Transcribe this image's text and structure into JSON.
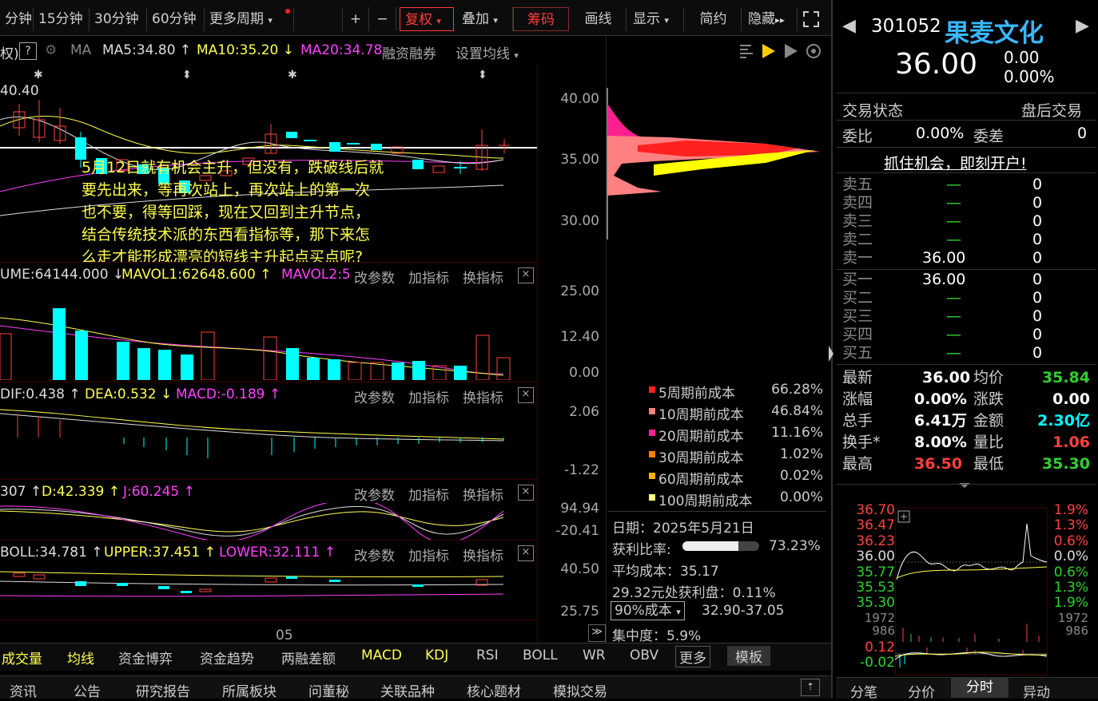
{
  "toolbar": {
    "periods": [
      "分钟",
      "15分钟",
      "30分钟",
      "60分钟",
      "更多周期"
    ],
    "plus": "+",
    "minus": "−",
    "fuquan": "复权",
    "diejia": "叠加",
    "chouma": "筹码",
    "huaxian": "画线",
    "xianshi": "显示",
    "jianyue": "简约",
    "yincang": "隐藏"
  },
  "ma_bar": {
    "prefix": "权)",
    "help": "?",
    "ma": "MA",
    "ma5": "MA5:34.80",
    "ma10": "MA10:35.20",
    "ma20": "MA20:34.78",
    "rongzi": "融资融券",
    "shezhi": "设置均线"
  },
  "price_chart": {
    "high_label": "40.40",
    "y_ticks": [
      "40.00",
      "35.00",
      "30.00"
    ],
    "annotation": [
      "5月12日就有机会主升，但没有，跌破线后就",
      "要先出来，等再次站上，再次站上的第一次",
      "也不要，得等回踩，现在又回到主升节点，",
      "结合传统技术派的东西看指标等，那下来怎",
      "么走才能形成漂亮的短线主升起点买点呢?"
    ]
  },
  "volume": {
    "vol": "UME:64144.000",
    "mavol1": "MAVOL1:62648.600",
    "mavol2": "MAVOL2:5",
    "y_ticks": [
      "25.00",
      "12.40",
      "0.00"
    ]
  },
  "macd": {
    "dif": "DIF:0.438",
    "dea": "DEA:0.532",
    "macd": "MACD:-0.189",
    "y_ticks": [
      "2.06",
      "-1.22"
    ]
  },
  "kdj": {
    "k": "307",
    "d": "D:42.339",
    "j": "J:60.245",
    "y_ticks": [
      "94.94",
      "-20.41"
    ]
  },
  "boll": {
    "boll": "BOLL:34.781",
    "upper": "UPPER:37.451",
    "lower": "LOWER:32.111",
    "y_ticks": [
      "40.50",
      "25.75"
    ]
  },
  "pane_buttons": {
    "gaicanshu": "改参数",
    "jiazhibiao": "加指标",
    "huanzhibiao": "换指标",
    "close": "×"
  },
  "x_axis_label": "05",
  "chip": {
    "legend": [
      {
        "label": "5周期前成本",
        "value": "66.28%",
        "color": "#ff2020"
      },
      {
        "label": "10周期前成本",
        "value": "46.84%",
        "color": "#ff8080"
      },
      {
        "label": "20周期前成本",
        "value": "11.16%",
        "color": "#ff2090"
      },
      {
        "label": "30周期前成本",
        "value": "1.02%",
        "color": "#ff8000"
      },
      {
        "label": "60周期前成本",
        "value": "0.02%",
        "color": "#ffb000"
      },
      {
        "label": "100周期前成本",
        "value": "0.00%",
        "color": "#ffff80"
      }
    ],
    "date": "日期：2025年5月21日",
    "profit_label": "获利比率:",
    "profit_value": "73.23%",
    "profit_ratio": 0.7323,
    "avg_cost": "平均成本：35.17",
    "profit_at": "29.32元处获利盘：0.11%",
    "cost_select": "90%成本",
    "cost_range": "32.90-37.05",
    "concentration": "集中度：5.9%"
  },
  "stock": {
    "code": "301052",
    "name": "果麦文化",
    "price": "36.00",
    "change": "0.00",
    "change_pct": "0.00%"
  },
  "quote": {
    "status_label": "交易状态",
    "status_value": "盘后交易",
    "weibi_label": "委比",
    "weibi_value": "0.00%",
    "weicha_label": "委差",
    "weicha_value": "0",
    "promo": "抓住机会，即刻开户!",
    "asks": [
      {
        "label": "卖五",
        "price": "—",
        "vol": "0"
      },
      {
        "label": "卖四",
        "price": "—",
        "vol": "0"
      },
      {
        "label": "卖三",
        "price": "—",
        "vol": "0"
      },
      {
        "label": "卖二",
        "price": "—",
        "vol": "0"
      },
      {
        "label": "卖一",
        "price": "36.00",
        "vol": "0"
      }
    ],
    "bids": [
      {
        "label": "买一",
        "price": "36.00",
        "vol": "0"
      },
      {
        "label": "买二",
        "price": "—",
        "vol": "0"
      },
      {
        "label": "买三",
        "price": "—",
        "vol": "0"
      },
      {
        "label": "买四",
        "price": "—",
        "vol": "0"
      },
      {
        "label": "买五",
        "price": "—",
        "vol": "0"
      }
    ],
    "stats": [
      {
        "l1": "最新",
        "v1": "36.00",
        "l2": "均价",
        "v2": "35.84",
        "c1": "#fff",
        "c2": "#30d030"
      },
      {
        "l1": "涨幅",
        "v1": "0.00%",
        "l2": "涨跌",
        "v2": "0.00",
        "c1": "#fff",
        "c2": "#fff"
      },
      {
        "l1": "总手",
        "v1": "6.41万",
        "l2": "金额",
        "v2": "2.30亿",
        "c1": "#fff",
        "c2": "#00ffff"
      },
      {
        "l1": "换手*",
        "v1": "8.00%",
        "l2": "量比",
        "v2": "1.06",
        "c1": "#fff",
        "c2": "#ff4040"
      },
      {
        "l1": "最高",
        "v1": "36.50",
        "l2": "最低",
        "v2": "35.30",
        "c1": "#ff4040",
        "c2": "#30d030"
      }
    ]
  },
  "minichart": {
    "left_ticks": [
      "36.70",
      "36.47",
      "36.23",
      "36.00",
      "35.77",
      "35.53",
      "35.30",
      "1972",
      "986",
      "0.12",
      "-0.02"
    ],
    "right_ticks": [
      "1.9%",
      "1.3%",
      "0.6%",
      "0.0%",
      "0.6%",
      "1.3%",
      "1.9%",
      "1972",
      "986"
    ]
  },
  "right_tabs": [
    "分笔",
    "分价",
    "分时",
    "异动"
  ],
  "indicator_tabs": [
    "成交量",
    "均线",
    "资金博弈",
    "资金趋势",
    "两融差额",
    "MACD",
    "KDJ",
    "RSI",
    "BOLL",
    "WR",
    "OBV",
    "更多",
    "模板"
  ],
  "nav_tabs": [
    "资讯",
    "公告",
    "研究报告",
    "所属板块",
    "问董秘",
    "关联品种",
    "核心题材",
    "模拟交易"
  ]
}
